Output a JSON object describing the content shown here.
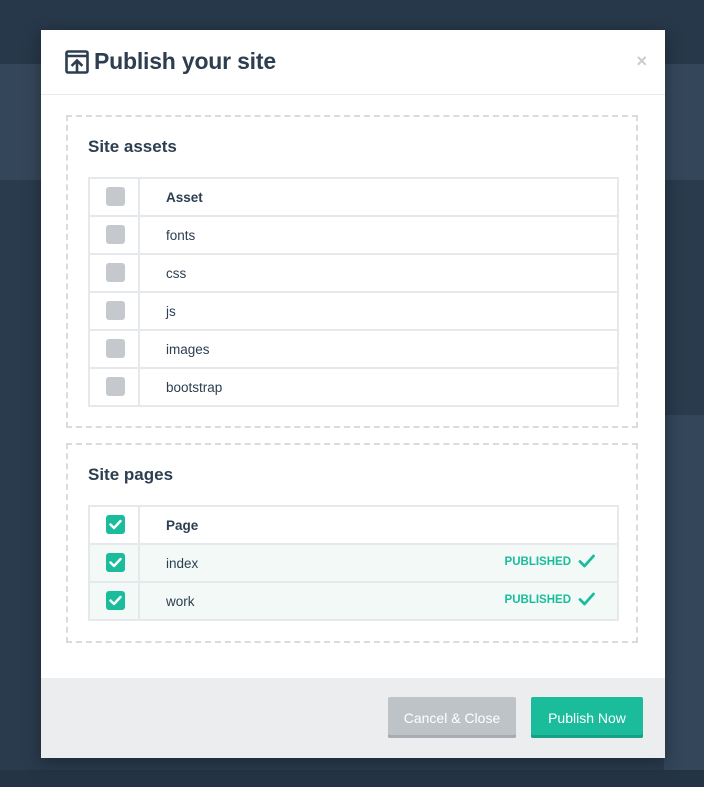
{
  "modal": {
    "title": "Publish your site",
    "close_label": "×"
  },
  "assets": {
    "title": "Site assets",
    "header": "Asset",
    "items": [
      {
        "label": "fonts"
      },
      {
        "label": "css"
      },
      {
        "label": "js"
      },
      {
        "label": "images"
      },
      {
        "label": "bootstrap"
      }
    ]
  },
  "pages": {
    "title": "Site pages",
    "header": "Page",
    "items": [
      {
        "label": "index",
        "status": "PUBLISHED"
      },
      {
        "label": "work",
        "status": "PUBLISHED"
      }
    ]
  },
  "footer": {
    "cancel_label": "Cancel & Close",
    "publish_label": "Publish Now"
  },
  "colors": {
    "accent": "#1abc9c",
    "title_text": "#2c3e50",
    "unchecked": "#c5c9cd",
    "cancel_button": "#bdc3c7"
  }
}
